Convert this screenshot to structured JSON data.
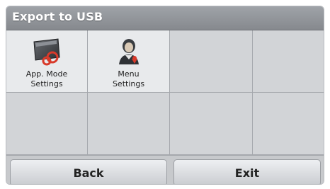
{
  "header": {
    "title": "Export to USB"
  },
  "tiles": [
    {
      "label_line1": "App. Mode",
      "label_line2": "Settings",
      "icon": "app-mode-settings-icon"
    },
    {
      "label_line1": "Menu",
      "label_line2": "Settings",
      "icon": "menu-settings-icon"
    }
  ],
  "footer": {
    "back_label": "Back",
    "exit_label": "Exit"
  },
  "colors": {
    "title_bar": "#8f9297",
    "accent": "#d83a2a"
  }
}
